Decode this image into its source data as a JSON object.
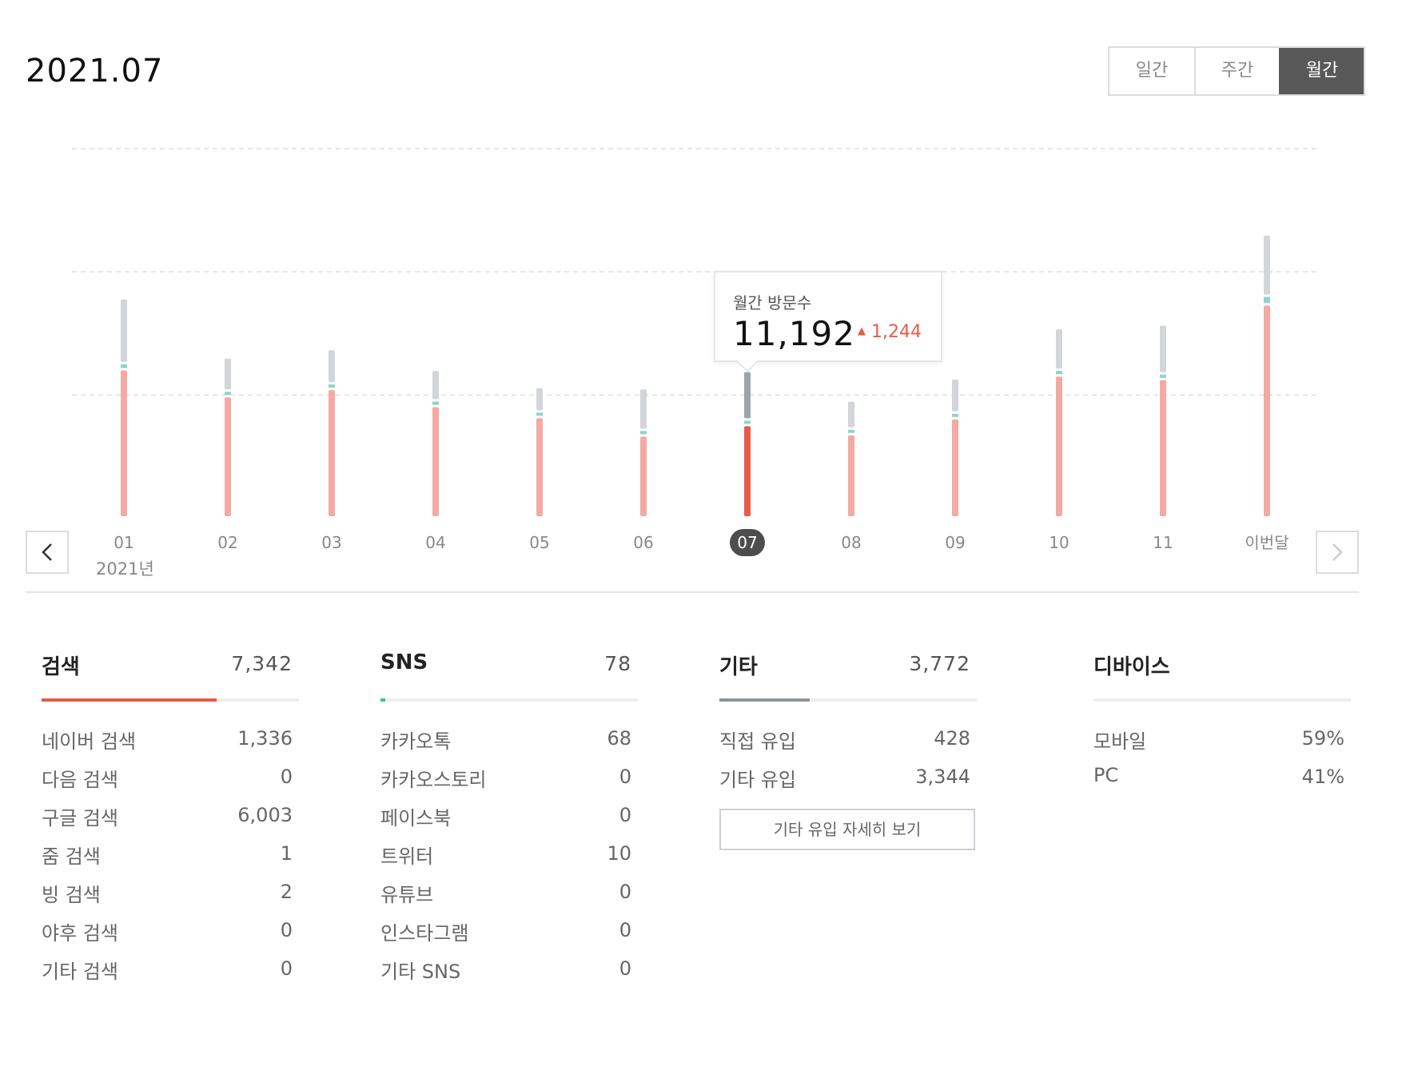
{
  "page": {
    "title": "2021.07"
  },
  "period_tabs": [
    {
      "label": "일간",
      "active": false
    },
    {
      "label": "주간",
      "active": false
    },
    {
      "label": "월간",
      "active": true
    }
  ],
  "chart": {
    "year_label": "2021년",
    "tooltip": {
      "title": "월간 방문수",
      "value": "11,192",
      "delta": "1,244",
      "direction": "up"
    },
    "colors": {
      "search": "#f2aaa3",
      "search_selected": "#e85a4a",
      "sns": "#8fd3cc",
      "other": "#d2d5d9",
      "other_selected": "#9ea3ab"
    }
  },
  "chart_data": {
    "type": "bar",
    "stacked": true,
    "categories": [
      "01",
      "02",
      "03",
      "04",
      "05",
      "06",
      "07",
      "08",
      "09",
      "10",
      "11",
      "이번달"
    ],
    "selected_index": 6,
    "series": [
      {
        "name": "검색",
        "values": [
          11900,
          9700,
          10300,
          8900,
          8000,
          6500,
          7342,
          6600,
          7900,
          11400,
          11100,
          17200
        ]
      },
      {
        "name": "SNS",
        "values": [
          300,
          250,
          150,
          50,
          100,
          80,
          78,
          50,
          200,
          250,
          250,
          500
        ]
      },
      {
        "name": "기타",
        "values": [
          5100,
          2500,
          2600,
          2300,
          1800,
          3200,
          3772,
          2100,
          2600,
          3200,
          3800,
          4800
        ]
      }
    ],
    "ylim": [
      0,
      30000
    ],
    "grid": true
  },
  "stats": {
    "search": {
      "title": "검색",
      "total": "7,342",
      "color": "#e85a4a",
      "fill": 0.68,
      "rows": [
        {
          "label": "네이버 검색",
          "value": "1,336"
        },
        {
          "label": "다음 검색",
          "value": "0"
        },
        {
          "label": "구글 검색",
          "value": "6,003"
        },
        {
          "label": "줌 검색",
          "value": "1"
        },
        {
          "label": "빙 검색",
          "value": "2"
        },
        {
          "label": "야후 검색",
          "value": "0"
        },
        {
          "label": "기타 검색",
          "value": "0"
        }
      ]
    },
    "sns": {
      "title": "SNS",
      "total": "78",
      "color": "#3cc0a8",
      "fill": 0.02,
      "rows": [
        {
          "label": "카카오톡",
          "value": "68"
        },
        {
          "label": "카카오스토리",
          "value": "0"
        },
        {
          "label": "페이스북",
          "value": "0"
        },
        {
          "label": "트위터",
          "value": "10"
        },
        {
          "label": "유튜브",
          "value": "0"
        },
        {
          "label": "인스타그램",
          "value": "0"
        },
        {
          "label": "기타 SNS",
          "value": "0"
        }
      ]
    },
    "other": {
      "title": "기타",
      "total": "3,772",
      "color": "#8f949b",
      "fill": 0.35,
      "rows": [
        {
          "label": "직접 유입",
          "value": "428"
        },
        {
          "label": "기타 유입",
          "value": "3,344"
        }
      ],
      "more_label": "기타 유입 자세히 보기"
    },
    "device": {
      "title": "디바이스",
      "rows": [
        {
          "label": "모바일",
          "value": "59%"
        },
        {
          "label": "PC",
          "value": "41%"
        }
      ]
    }
  }
}
